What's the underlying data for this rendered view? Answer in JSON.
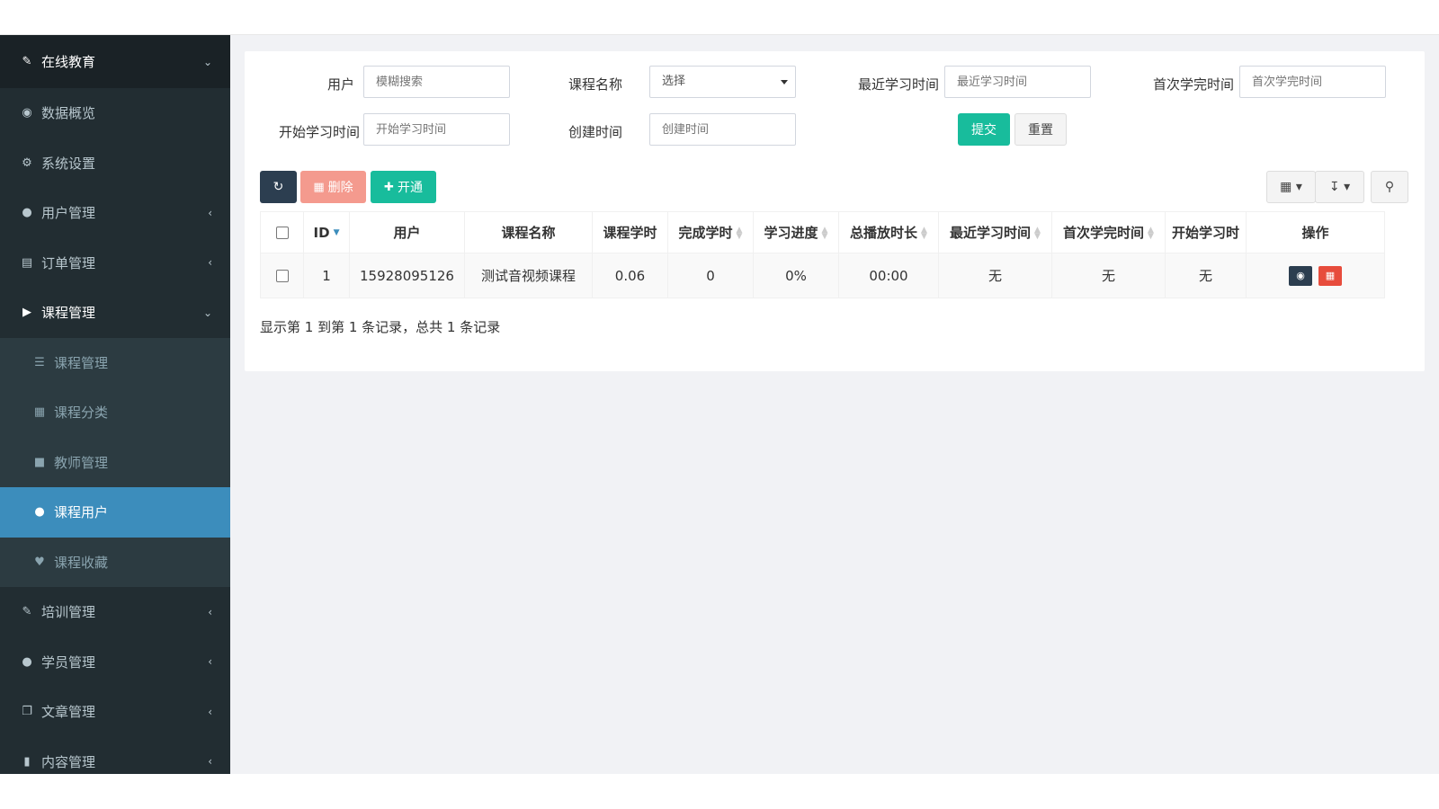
{
  "sidebar": {
    "header": "在线教育",
    "items": [
      {
        "label": "数据概览",
        "icon": "dashboard-icon"
      },
      {
        "label": "系统设置",
        "icon": "cogs-icon"
      },
      {
        "label": "用户管理",
        "icon": "user-icon"
      },
      {
        "label": "订单管理",
        "icon": "list-alt-icon"
      },
      {
        "label": "课程管理",
        "icon": "play-circle-icon"
      },
      {
        "label": "课程管理",
        "icon": "list-icon"
      },
      {
        "label": "课程分类",
        "icon": "th-large-icon"
      },
      {
        "label": "教师管理",
        "icon": "lock-icon"
      },
      {
        "label": "课程用户",
        "icon": "user-icon"
      },
      {
        "label": "课程收藏",
        "icon": "heart-icon"
      },
      {
        "label": "培训管理",
        "icon": "leaf-icon"
      },
      {
        "label": "学员管理",
        "icon": "users-icon"
      },
      {
        "label": "文章管理",
        "icon": "clone-icon"
      },
      {
        "label": "内容管理",
        "icon": "file-icon"
      }
    ]
  },
  "filters": {
    "user_label": "用户",
    "user_placeholder": "模糊搜索",
    "course_label": "课程名称",
    "course_value": "选择",
    "recent_label": "最近学习时间",
    "recent_placeholder": "最近学习时间",
    "first_done_label": "首次学完时间",
    "first_done_placeholder": "首次学完时间",
    "start_label": "开始学习时间",
    "start_placeholder": "开始学习时间",
    "created_label": "创建时间",
    "created_placeholder": "创建时间",
    "submit": "提交",
    "reset": "重置"
  },
  "toolbar": {
    "delete": "删除",
    "open": "开通"
  },
  "table": {
    "headers": [
      "ID",
      "用户",
      "课程名称",
      "课程学时",
      "完成学时",
      "学习进度",
      "总播放时长",
      "最近学习时间",
      "首次学完时间",
      "开始学习时",
      "操作"
    ],
    "rows": [
      [
        "1",
        "15928095126",
        "测试音视频课程",
        "0.06",
        "0",
        "0%",
        "00:00",
        "无",
        "无",
        "无"
      ]
    ]
  },
  "summary": "显示第 1 到第 1 条记录，总共 1 条记录",
  "colors": {
    "sidebar_bg": "#222d32",
    "active": "#3c8dbc",
    "success": "#18bc9c",
    "danger": "#e74c3c"
  }
}
